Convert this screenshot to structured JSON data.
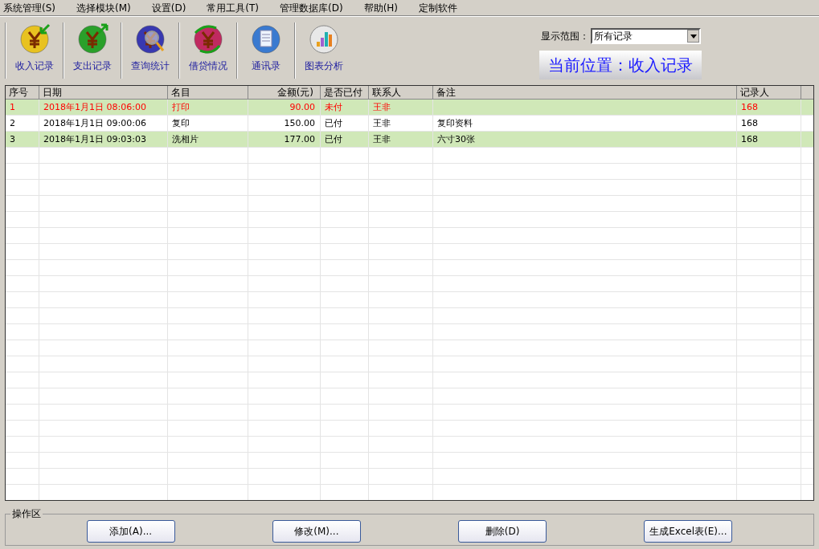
{
  "menu": [
    "系统管理(S)",
    "选择模块(M)",
    "设置(D)",
    "常用工具(T)",
    "管理数据库(D)",
    "帮助(H)",
    "定制软件"
  ],
  "toolbar": [
    {
      "label": "收入记录",
      "kind": "income"
    },
    {
      "label": "支出记录",
      "kind": "expense"
    },
    {
      "label": "查询统计",
      "kind": "query"
    },
    {
      "label": "借贷情况",
      "kind": "loan"
    },
    {
      "label": "通讯录",
      "kind": "contacts"
    },
    {
      "label": "图表分析",
      "kind": "chart"
    }
  ],
  "range": {
    "label": "显示范围：",
    "value": "所有记录"
  },
  "location": "当前位置：收入记录",
  "table": {
    "columns": [
      "序号",
      "日期",
      "名目",
      "金额(元)",
      "是否已付",
      "联系人",
      "备注",
      "记录人"
    ],
    "rows": [
      {
        "cells": [
          "1",
          "2018年1月1日 08:06:00",
          "打印",
          "90.00",
          "未付",
          "王非",
          "",
          "168"
        ],
        "paid": false
      },
      {
        "cells": [
          "2",
          "2018年1月1日 09:00:06",
          "复印",
          "150.00",
          "已付",
          "王非",
          "复印资料",
          "168"
        ],
        "paid": true
      },
      {
        "cells": [
          "3",
          "2018年1月1日 09:03:03",
          "洗相片",
          "177.00",
          "已付",
          "王非",
          "六寸30张",
          "168"
        ],
        "paid": true
      }
    ]
  },
  "actions": {
    "title": "操作区",
    "buttons": [
      "添加(A)...",
      "修改(M)...",
      "删除(D)",
      "生成Excel表(E)..."
    ]
  }
}
